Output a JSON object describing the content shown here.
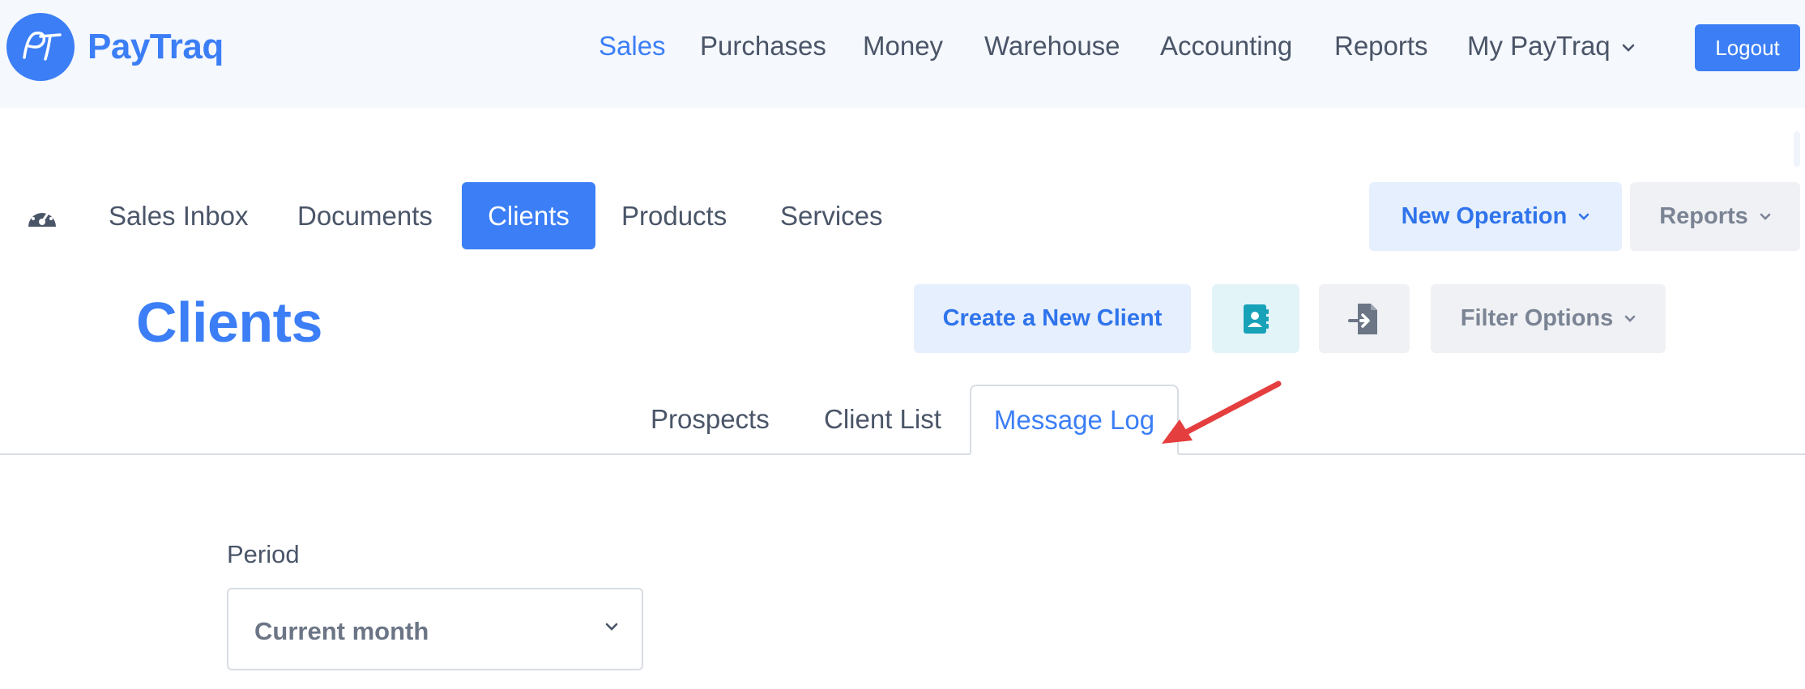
{
  "brand": {
    "name": "PayTraq",
    "monogram": "PT",
    "color": "#3b7ef6"
  },
  "topnav": {
    "items": [
      {
        "label": "Sales",
        "active": true
      },
      {
        "label": "Purchases"
      },
      {
        "label": "Money"
      },
      {
        "label": "Warehouse"
      },
      {
        "label": "Accounting"
      },
      {
        "label": "Reports"
      },
      {
        "label": "My PayTraq"
      }
    ],
    "logout_label": "Logout"
  },
  "subnav": {
    "dashboard_icon": "speedometer-icon",
    "items": [
      {
        "label": "Sales Inbox"
      },
      {
        "label": "Documents"
      },
      {
        "label": "Clients",
        "active": true
      },
      {
        "label": "Products"
      },
      {
        "label": "Services"
      }
    ],
    "new_operation_label": "New Operation",
    "reports_label": "Reports"
  },
  "page": {
    "title": "Clients",
    "create_client_label": "Create a New Client",
    "contact_icon": "contact-book-icon",
    "import_icon": "file-import-icon",
    "filter_label": "Filter Options"
  },
  "tabs": [
    {
      "label": "Prospects"
    },
    {
      "label": "Client List"
    },
    {
      "label": "Message Log",
      "active": true
    }
  ],
  "filters": {
    "period_label": "Period",
    "period_value": "Current month"
  },
  "colors": {
    "accent": "#3b7ef6",
    "annotation_arrow": "#e53e3e"
  }
}
